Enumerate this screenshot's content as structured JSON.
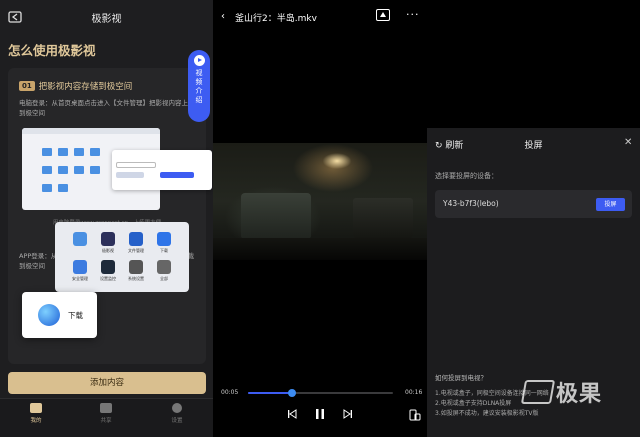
{
  "left": {
    "title": "极影视",
    "heading": "怎么使用极影视",
    "step_num": "01",
    "step_title": "把影视内容存储到极空间",
    "desc_pc": "电脑登录：从首页桌面点击进入【文件管理】把影视内容上传到极空间",
    "caption": "用电脑登录www.zconnect.cn，上传更方便",
    "desc_app": "APP登录：从首页桌面点击进入【下载】通过“下载”工具下载到极空间",
    "video_tab": [
      "视",
      "频",
      "介",
      "绍"
    ],
    "popup_label": "下载",
    "app_icons": [
      "极影视",
      "文件管理",
      "下载",
      "安全管理",
      "设置监控",
      "系统设置",
      "全部"
    ],
    "add_button": "添加内容",
    "tabs": [
      {
        "label": "我的",
        "active": true
      },
      {
        "label": "共享",
        "active": false
      },
      {
        "label": "设置",
        "active": false
      }
    ],
    "colors": {
      "accent": "#e0c89a",
      "button": "#d9bf8f",
      "blue": "#3d5cf2"
    }
  },
  "player": {
    "back_icon": "chevron-left-icon",
    "filename": "釜山行2：半岛.mkv",
    "time_current": "00:05",
    "time_total": "00:16",
    "progress": 0.3
  },
  "cast": {
    "refresh": "刷新",
    "title": "投屏",
    "hint": "选择要投屏的设备：",
    "device_name": "Y43-b7f3(lebo)",
    "device_button": "投屏",
    "faq_title": "如何投屏到电视？",
    "faq": [
      "1.电视或盒子，同极空间设备连接同一网络",
      "2.电视或盒子支持DLNA投屏",
      "3.如投屏不成功，建议安装极影视TV版"
    ]
  },
  "watermark": "极果"
}
